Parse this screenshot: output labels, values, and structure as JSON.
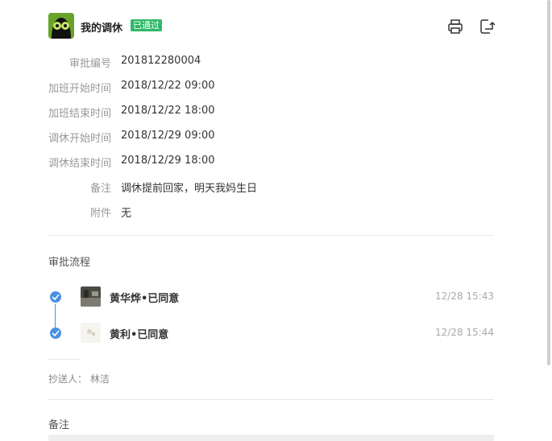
{
  "header": {
    "title": "我的调休",
    "status_badge": "已通过",
    "print_icon": "printer-icon",
    "export_icon": "export-icon"
  },
  "details": [
    {
      "label": "审批编号",
      "value": "201812280004"
    },
    {
      "label": "加班开始时间",
      "value": "2018/12/22 09:00"
    },
    {
      "label": "加班结束时间",
      "value": "2018/12/22 18:00"
    },
    {
      "label": "调休开始时间",
      "value": "2018/12/29 09:00"
    },
    {
      "label": "调休结束时间",
      "value": "2018/12/29 18:00"
    },
    {
      "label": "备注",
      "value": "调休提前回家，明天我妈生日"
    },
    {
      "label": "附件",
      "value": "无"
    }
  ],
  "approval_flow": {
    "title": "审批流程",
    "steps": [
      {
        "name": "黄华烨•已同意",
        "time": "12/28 15:43"
      },
      {
        "name": "黄利•已同意",
        "time": "12/28 15:44"
      }
    ]
  },
  "cc": {
    "text": "抄送人： 林洁"
  },
  "remarks_section": {
    "title": "备注"
  },
  "colors": {
    "badge": "#2fb869",
    "flow_accent": "#4a90e2",
    "label": "#999999"
  }
}
